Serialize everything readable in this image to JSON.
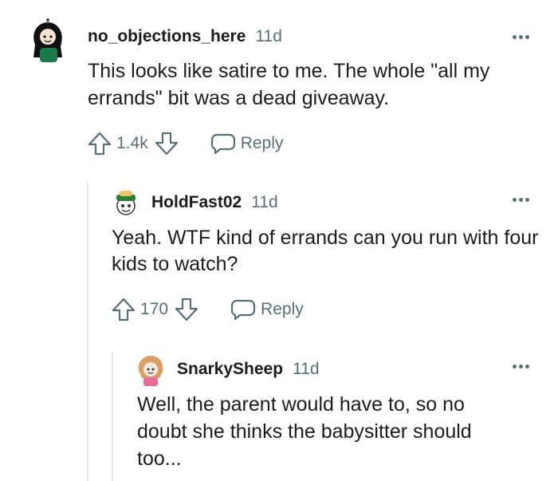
{
  "comments": [
    {
      "username": "no_objections_here",
      "time": "11d",
      "body": "This looks like satire to me. The whole \"all my errands\" bit was a dead giveaway.",
      "score": "1.4k",
      "reply_label": "Reply",
      "avatar_icon": "snoo-avatar-dark-hair"
    },
    {
      "username": "HoldFast02",
      "time": "11d",
      "body": "Yeah. WTF kind of errands can you run with four kids to watch?",
      "score": "170",
      "reply_label": "Reply",
      "avatar_icon": "snoo-avatar-green-hat"
    },
    {
      "username": "SnarkySheep",
      "time": "11d",
      "body": "Well, the parent would have to, so no doubt she thinks the babysitter should too...",
      "avatar_icon": "snoo-avatar-pink"
    }
  ],
  "colors": {
    "text": "#1c1c1c",
    "meta": "#576f76",
    "thread_line": "#e5e8ea"
  }
}
